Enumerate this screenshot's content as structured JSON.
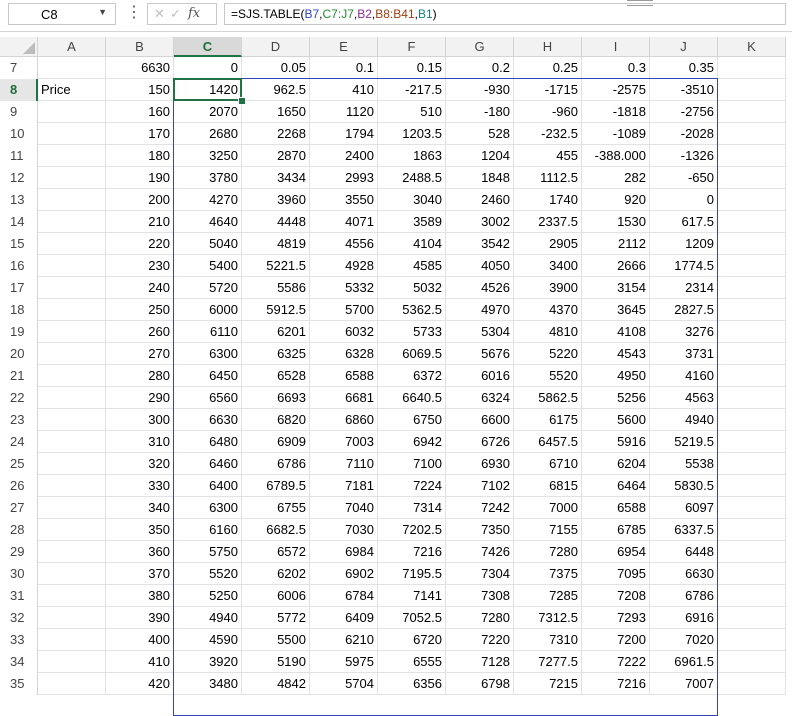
{
  "formula_bar": {
    "name_box": "C8",
    "formula_parts": [
      {
        "text": "=SJS.TABLE(",
        "color": "#000000"
      },
      {
        "text": "B7",
        "color": "#2f45c8"
      },
      {
        "text": ",",
        "color": "#000000"
      },
      {
        "text": "C7:J7",
        "color": "#1f8a2d"
      },
      {
        "text": ",",
        "color": "#000000"
      },
      {
        "text": "B2",
        "color": "#8a2f9a"
      },
      {
        "text": ",",
        "color": "#000000"
      },
      {
        "text": "B8:B41",
        "color": "#a04010"
      },
      {
        "text": ",",
        "color": "#000000"
      },
      {
        "text": "B1",
        "color": "#158080"
      },
      {
        "text": ")",
        "color": "#000000"
      }
    ],
    "fx_label": "fx"
  },
  "columns": [
    "A",
    "B",
    "C",
    "D",
    "E",
    "F",
    "G",
    "H",
    "I",
    "J",
    "K"
  ],
  "active_column": "C",
  "active_row": "8",
  "rows": [
    {
      "row": "7",
      "cells": [
        "",
        "6630",
        "0",
        "0.05",
        "0.1",
        "0.15",
        "0.2",
        "0.25",
        "0.3",
        "0.35",
        ""
      ]
    },
    {
      "row": "8",
      "cells": [
        "Price",
        "150",
        "1420",
        "962.5",
        "410",
        "-217.5",
        "-930",
        "-1715",
        "-2575",
        "-3510",
        ""
      ]
    },
    {
      "row": "9",
      "cells": [
        "",
        "160",
        "2070",
        "1650",
        "1120",
        "510",
        "-180",
        "-960",
        "-1818",
        "-2756",
        ""
      ]
    },
    {
      "row": "10",
      "cells": [
        "",
        "170",
        "2680",
        "2268",
        "1794",
        "1203.5",
        "528",
        "-232.5",
        "-1089",
        "-2028",
        ""
      ]
    },
    {
      "row": "11",
      "cells": [
        "",
        "180",
        "3250",
        "2870",
        "2400",
        "1863",
        "1204",
        "455",
        "-388.000",
        "-1326",
        ""
      ]
    },
    {
      "row": "12",
      "cells": [
        "",
        "190",
        "3780",
        "3434",
        "2993",
        "2488.5",
        "1848",
        "1112.5",
        "282",
        "-650",
        ""
      ]
    },
    {
      "row": "13",
      "cells": [
        "",
        "200",
        "4270",
        "3960",
        "3550",
        "3040",
        "2460",
        "1740",
        "920",
        "0",
        ""
      ]
    },
    {
      "row": "14",
      "cells": [
        "",
        "210",
        "4640",
        "4448",
        "4071",
        "3589",
        "3002",
        "2337.5",
        "1530",
        "617.5",
        ""
      ]
    },
    {
      "row": "15",
      "cells": [
        "",
        "220",
        "5040",
        "4819",
        "4556",
        "4104",
        "3542",
        "2905",
        "2112",
        "1209",
        ""
      ]
    },
    {
      "row": "16",
      "cells": [
        "",
        "230",
        "5400",
        "5221.5",
        "4928",
        "4585",
        "4050",
        "3400",
        "2666",
        "1774.5",
        ""
      ]
    },
    {
      "row": "17",
      "cells": [
        "",
        "240",
        "5720",
        "5586",
        "5332",
        "5032",
        "4526",
        "3900",
        "3154",
        "2314",
        ""
      ]
    },
    {
      "row": "18",
      "cells": [
        "",
        "250",
        "6000",
        "5912.5",
        "5700",
        "5362.5",
        "4970",
        "4370",
        "3645",
        "2827.5",
        ""
      ]
    },
    {
      "row": "19",
      "cells": [
        "",
        "260",
        "6110",
        "6201",
        "6032",
        "5733",
        "5304",
        "4810",
        "4108",
        "3276",
        ""
      ]
    },
    {
      "row": "20",
      "cells": [
        "",
        "270",
        "6300",
        "6325",
        "6328",
        "6069.5",
        "5676",
        "5220",
        "4543",
        "3731",
        ""
      ]
    },
    {
      "row": "21",
      "cells": [
        "",
        "280",
        "6450",
        "6528",
        "6588",
        "6372",
        "6016",
        "5520",
        "4950",
        "4160",
        ""
      ]
    },
    {
      "row": "22",
      "cells": [
        "",
        "290",
        "6560",
        "6693",
        "6681",
        "6640.5",
        "6324",
        "5862.5",
        "5256",
        "4563",
        ""
      ]
    },
    {
      "row": "23",
      "cells": [
        "",
        "300",
        "6630",
        "6820",
        "6860",
        "6750",
        "6600",
        "6175",
        "5600",
        "4940",
        ""
      ]
    },
    {
      "row": "24",
      "cells": [
        "",
        "310",
        "6480",
        "6909",
        "7003",
        "6942",
        "6726",
        "6457.5",
        "5916",
        "5219.5",
        ""
      ]
    },
    {
      "row": "25",
      "cells": [
        "",
        "320",
        "6460",
        "6786",
        "7110",
        "7100",
        "6930",
        "6710",
        "6204",
        "5538",
        ""
      ]
    },
    {
      "row": "26",
      "cells": [
        "",
        "330",
        "6400",
        "6789.5",
        "7181",
        "7224",
        "7102",
        "6815",
        "6464",
        "5830.5",
        ""
      ]
    },
    {
      "row": "27",
      "cells": [
        "",
        "340",
        "6300",
        "6755",
        "7040",
        "7314",
        "7242",
        "7000",
        "6588",
        "6097",
        ""
      ]
    },
    {
      "row": "28",
      "cells": [
        "",
        "350",
        "6160",
        "6682.5",
        "7030",
        "7202.5",
        "7350",
        "7155",
        "6785",
        "6337.5",
        ""
      ]
    },
    {
      "row": "29",
      "cells": [
        "",
        "360",
        "5750",
        "6572",
        "6984",
        "7216",
        "7426",
        "7280",
        "6954",
        "6448",
        ""
      ]
    },
    {
      "row": "30",
      "cells": [
        "",
        "370",
        "5520",
        "6202",
        "6902",
        "7195.5",
        "7304",
        "7375",
        "7095",
        "6630",
        ""
      ]
    },
    {
      "row": "31",
      "cells": [
        "",
        "380",
        "5250",
        "6006",
        "6784",
        "7141",
        "7308",
        "7285",
        "7208",
        "6786",
        ""
      ]
    },
    {
      "row": "32",
      "cells": [
        "",
        "390",
        "4940",
        "5772",
        "6409",
        "7052.5",
        "7280",
        "7312.5",
        "7293",
        "6916",
        ""
      ]
    },
    {
      "row": "33",
      "cells": [
        "",
        "400",
        "4590",
        "5500",
        "6210",
        "6720",
        "7220",
        "7310",
        "7200",
        "7020",
        ""
      ]
    },
    {
      "row": "34",
      "cells": [
        "",
        "410",
        "3920",
        "5190",
        "5975",
        "6555",
        "7128",
        "7277.5",
        "7222",
        "6961.5",
        ""
      ]
    },
    {
      "row": "35",
      "cells": [
        "",
        "420",
        "3480",
        "4842",
        "5704",
        "6356",
        "6798",
        "7215",
        "7216",
        "7007",
        ""
      ]
    }
  ],
  "colors": {
    "active_accent": "#217346",
    "table_frame": "#3346b8",
    "header_bg": "#f2f2f2",
    "gridline": "#e2e2e2"
  }
}
